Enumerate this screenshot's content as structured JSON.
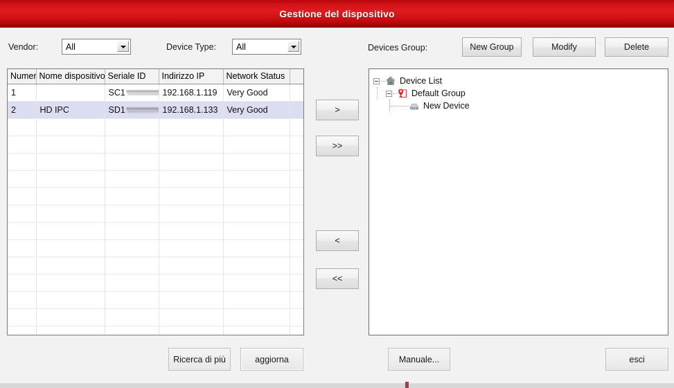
{
  "window": {
    "title": "Gestione del dispositivo",
    "accent_color": "#d01216",
    "focus_border_color": "#b03030",
    "background_color": "#f2f2f2"
  },
  "filters": {
    "vendor_label": "Vendor:",
    "vendor_value": "All",
    "device_type_label": "Device Type:",
    "device_type_value": "All"
  },
  "devices_group": {
    "label": "Devices Group:",
    "new_group_button": "New Group",
    "modify_button": "Modify",
    "delete_button": "Delete"
  },
  "device_table": {
    "columns": [
      "Numero",
      "Nome dispositivo",
      "Seriale ID",
      "Indirizzo IP",
      "Network Status"
    ],
    "rows": [
      {
        "number": "1",
        "name": "",
        "serial_prefix": "SC1",
        "serial_redacted": true,
        "ip": "192.168.1.119",
        "status": "Very Good",
        "selected": false
      },
      {
        "number": "2",
        "name": "HD IPC",
        "serial_prefix": "SD1",
        "serial_redacted": true,
        "ip": "192.168.1.133",
        "status": "Very Good",
        "selected": true
      }
    ],
    "empty_row_count": 13,
    "selected_row_color": "#dcdcf2"
  },
  "transfer_buttons": [
    {
      "label": ">",
      "name": "move-right-one"
    },
    {
      "label": ">>",
      "name": "move-right-all"
    },
    {
      "label": "<",
      "name": "move-left-one"
    },
    {
      "label": "<<",
      "name": "move-left-all"
    }
  ],
  "tree": {
    "root": {
      "label": "Device List",
      "icon": "house-icon",
      "expanded": true
    },
    "group": {
      "label": "Default Group",
      "icon": "map-pin-icon",
      "icon_color": "#e03030",
      "expanded": true
    },
    "device": {
      "label": "New Device",
      "icon": "device-icon"
    }
  },
  "footer": {
    "search_more_button": "Ricerca di più",
    "refresh_button": "aggiorna",
    "manual_button": "Manuale...",
    "exit_button": "esci"
  }
}
